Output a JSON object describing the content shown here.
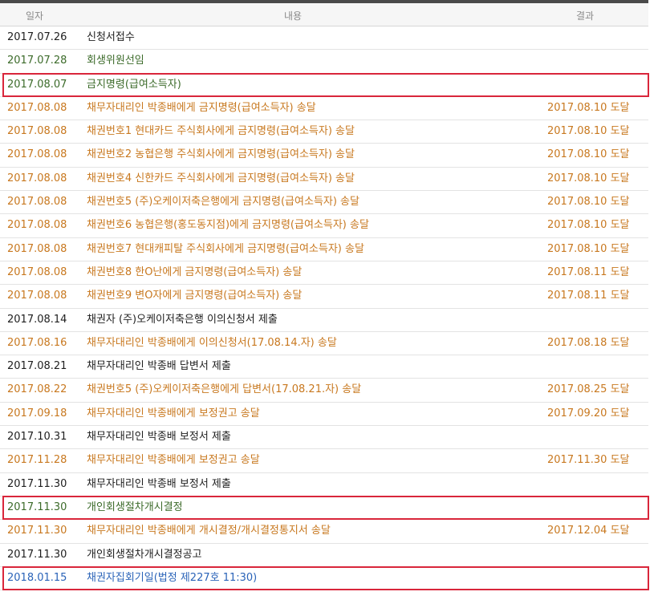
{
  "header": {
    "date": "일자",
    "content": "내용",
    "result": "결과"
  },
  "colors": {
    "black": "#1e1e1e",
    "green": "#3c6b2a",
    "orange": "#c8781f",
    "blue": "#2a63b8",
    "highlight": "#d9263b"
  },
  "rows": [
    {
      "date": "2017.07.26",
      "content": "신청서접수",
      "result": "",
      "tone": "black",
      "hl": false
    },
    {
      "date": "2017.07.28",
      "content": "회생위원선임",
      "result": "",
      "tone": "green",
      "hl": false
    },
    {
      "date": "2017.08.07",
      "content": "금지명령(급여소득자)",
      "result": "",
      "tone": "green",
      "hl": true
    },
    {
      "date": "2017.08.08",
      "content": "채무자대리인 박종배에게 금지명령(급여소득자) 송달",
      "result": "2017.08.10 도달",
      "tone": "orange",
      "hl": false
    },
    {
      "date": "2017.08.08",
      "content": "채권번호1 현대카드 주식회사에게 금지명령(급여소득자) 송달",
      "result": "2017.08.10 도달",
      "tone": "orange",
      "hl": false
    },
    {
      "date": "2017.08.08",
      "content": "채권번호2 농협은행 주식회사에게 금지명령(급여소득자) 송달",
      "result": "2017.08.10 도달",
      "tone": "orange",
      "hl": false
    },
    {
      "date": "2017.08.08",
      "content": "채권번호4 신한카드 주식회사에게 금지명령(급여소득자) 송달",
      "result": "2017.08.10 도달",
      "tone": "orange",
      "hl": false
    },
    {
      "date": "2017.08.08",
      "content": "채권번호5 (주)오케이저축은행에게 금지명령(급여소득자) 송달",
      "result": "2017.08.10 도달",
      "tone": "orange",
      "hl": false
    },
    {
      "date": "2017.08.08",
      "content": "채권번호6 농협은행(홍도동지점)에게 금지명령(급여소득자) 송달",
      "result": "2017.08.10 도달",
      "tone": "orange",
      "hl": false
    },
    {
      "date": "2017.08.08",
      "content": "채권번호7 현대캐피탈 주식회사에게 금지명령(급여소득자) 송달",
      "result": "2017.08.10 도달",
      "tone": "orange",
      "hl": false
    },
    {
      "date": "2017.08.08",
      "content": "채권번호8 한O난에게 금지명령(급여소득자) 송달",
      "result": "2017.08.11 도달",
      "tone": "orange",
      "hl": false
    },
    {
      "date": "2017.08.08",
      "content": "채권번호9 변O자에게 금지명령(급여소득자) 송달",
      "result": "2017.08.11 도달",
      "tone": "orange",
      "hl": false
    },
    {
      "date": "2017.08.14",
      "content": "채권자 (주)오케이저축은행 이의신청서 제출",
      "result": "",
      "tone": "black",
      "hl": false
    },
    {
      "date": "2017.08.16",
      "content": "채무자대리인 박종배에게 이의신청서(17.08.14.자) 송달",
      "result": "2017.08.18 도달",
      "tone": "orange",
      "hl": false
    },
    {
      "date": "2017.08.21",
      "content": "채무자대리인 박종배 답변서 제출",
      "result": "",
      "tone": "black",
      "hl": false
    },
    {
      "date": "2017.08.22",
      "content": "채권번호5 (주)오케이저축은행에게 답변서(17.08.21.자) 송달",
      "result": "2017.08.25 도달",
      "tone": "orange",
      "hl": false
    },
    {
      "date": "2017.09.18",
      "content": "채무자대리인 박종배에게 보정권고 송달",
      "result": "2017.09.20 도달",
      "tone": "orange",
      "hl": false
    },
    {
      "date": "2017.10.31",
      "content": "채무자대리인 박종배 보정서 제출",
      "result": "",
      "tone": "black",
      "hl": false
    },
    {
      "date": "2017.11.28",
      "content": "채무자대리인 박종배에게 보정권고 송달",
      "result": "2017.11.30 도달",
      "tone": "orange",
      "hl": false
    },
    {
      "date": "2017.11.30",
      "content": "채무자대리인 박종배 보정서 제출",
      "result": "",
      "tone": "black",
      "hl": false
    },
    {
      "date": "2017.11.30",
      "content": "개인회생절차개시결정",
      "result": "",
      "tone": "green",
      "hl": true
    },
    {
      "date": "2017.11.30",
      "content": "채무자대리인 박종배에게 개시결정/개시결정통지서 송달",
      "result": "2017.12.04 도달",
      "tone": "orange",
      "hl": false
    },
    {
      "date": "2017.11.30",
      "content": "개인회생절차개시결정공고",
      "result": "",
      "tone": "black",
      "hl": false
    },
    {
      "date": "2018.01.15",
      "content": "채권자집회기일(법정 제227호 11:30)",
      "result": "",
      "tone": "blue",
      "hl": true
    }
  ]
}
